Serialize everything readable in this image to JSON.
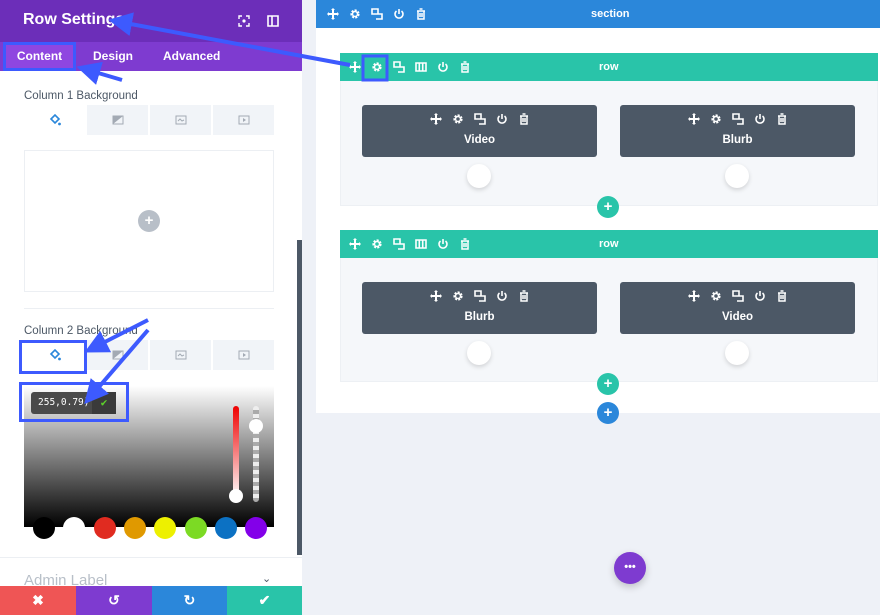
{
  "panel": {
    "title": "Row Settings",
    "tabs": [
      "Content",
      "Design",
      "Advanced"
    ],
    "active_tab": "Content",
    "col1_label": "Column 1 Background",
    "col2_label": "Column 2 Background",
    "bg_tabs": [
      "paint-bucket-icon",
      "gradient-icon",
      "image-icon",
      "video-icon"
    ],
    "color_value": "255,0.79)",
    "admin_label": "Admin Label",
    "swatches": [
      "#000000",
      "#ffffff",
      "#e02b20",
      "#e09900",
      "#edf000",
      "#7cda24",
      "#0c71c3",
      "#8300e9"
    ],
    "footer": {
      "cancel": "✖",
      "undo": "↺",
      "redo": "↻",
      "save": "✔"
    },
    "footer_colors": [
      "#ef5555",
      "#7e3bd0",
      "#2b87da",
      "#29c4a9"
    ]
  },
  "canvas": {
    "section_label": "section",
    "rows": [
      {
        "label": "row",
        "modules": [
          "Video",
          "Blurb"
        ]
      },
      {
        "label": "row",
        "modules": [
          "Blurb",
          "Video"
        ]
      }
    ],
    "add_label": "+",
    "menu_label": "•••"
  },
  "colors": {
    "accent": "#7e3bd0",
    "section": "#2b87da",
    "row": "#29c4a9",
    "module": "#4c5866",
    "annotation": "#3d5afe"
  }
}
